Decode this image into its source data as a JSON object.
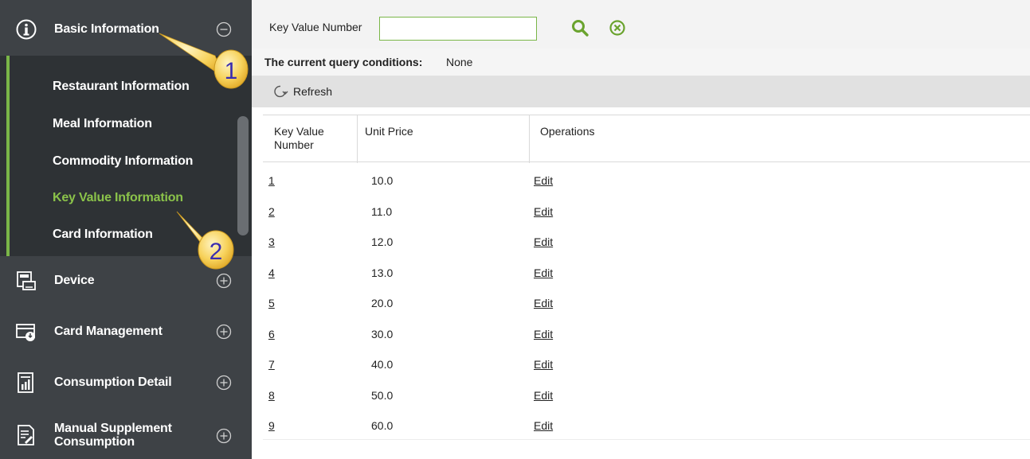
{
  "sidebar": {
    "basic": {
      "label": "Basic Information",
      "icon": "info-circle-icon",
      "toggle": "collapse"
    },
    "sub_items": [
      {
        "label": "Restaurant Information"
      },
      {
        "label": "Meal Information"
      },
      {
        "label": "Commodity Information"
      },
      {
        "label": "Key Value Information",
        "active": true
      },
      {
        "label": "Card Information"
      }
    ],
    "sections": [
      {
        "label": "Device",
        "icon": "device-icon"
      },
      {
        "label": "Card Management",
        "icon": "card-management-icon"
      },
      {
        "label": "Consumption Detail",
        "icon": "report-icon"
      },
      {
        "label": "Manual Supplement",
        "label2": "Consumption",
        "icon": "document-edit-icon"
      }
    ]
  },
  "callouts": [
    "1",
    "2"
  ],
  "search": {
    "label": "Key Value Number",
    "value": ""
  },
  "query": {
    "label": "The current query conditions:",
    "value": "None"
  },
  "toolbar": {
    "refresh_label": "Refresh"
  },
  "table": {
    "headers": {
      "key_line1": "Key Value",
      "key_line2": "Number",
      "price": "Unit Price",
      "operations": "Operations"
    },
    "rows": [
      {
        "key": "1",
        "price": "10.0",
        "op": "Edit"
      },
      {
        "key": "2",
        "price": "11.0",
        "op": "Edit"
      },
      {
        "key": "3",
        "price": "12.0",
        "op": "Edit"
      },
      {
        "key": "4",
        "price": "13.0",
        "op": "Edit"
      },
      {
        "key": "5",
        "price": "20.0",
        "op": "Edit"
      },
      {
        "key": "6",
        "price": "30.0",
        "op": "Edit"
      },
      {
        "key": "7",
        "price": "40.0",
        "op": "Edit"
      },
      {
        "key": "8",
        "price": "50.0",
        "op": "Edit"
      },
      {
        "key": "9",
        "price": "60.0",
        "op": "Edit"
      }
    ]
  },
  "colors": {
    "accent_green": "#7ab648",
    "sidebar_bg": "#3e4246",
    "callout_yellow": "#f7d25b",
    "callout_text": "#3a2db0"
  }
}
